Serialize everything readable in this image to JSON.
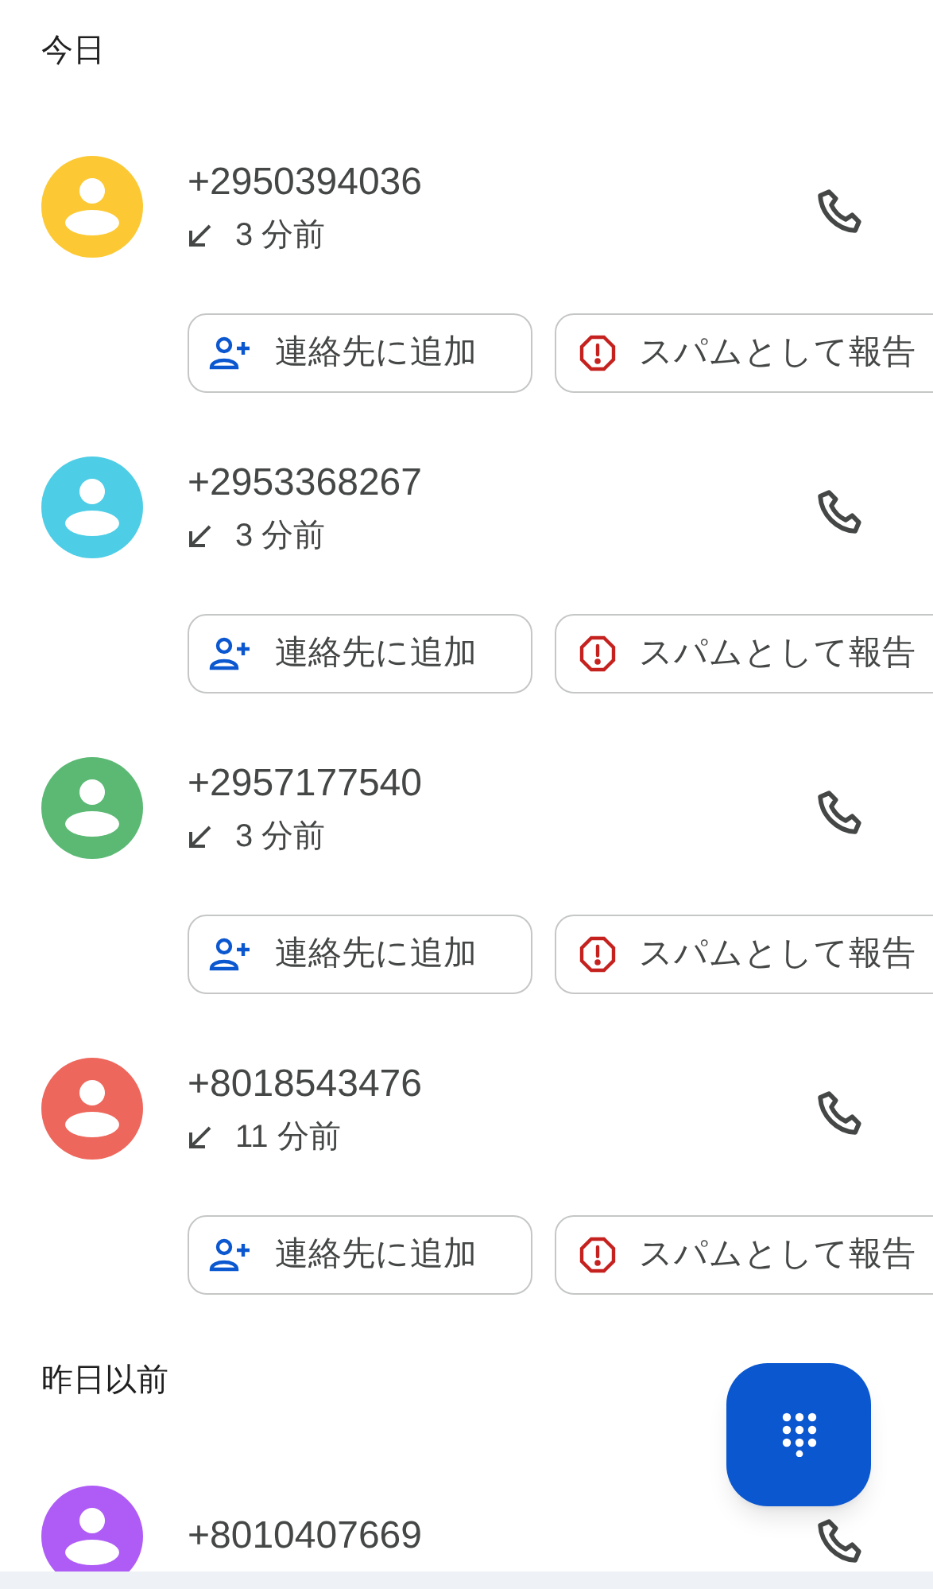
{
  "sections": [
    {
      "title": "今日",
      "calls": [
        {
          "number": "+2950394036",
          "time": "3 分前",
          "color": "#fcc934",
          "actions": [
            {
              "kind": "add_contact",
              "label": "連絡先に追加"
            },
            {
              "kind": "report_spam",
              "label": "スパムとして報告"
            }
          ]
        },
        {
          "number": "+2953368267",
          "time": "3 分前",
          "color": "#4ecde6",
          "actions": [
            {
              "kind": "add_contact",
              "label": "連絡先に追加"
            },
            {
              "kind": "report_spam",
              "label": "スパムとして報告"
            }
          ]
        },
        {
          "number": "+2957177540",
          "time": "3 分前",
          "color": "#5bb974",
          "actions": [
            {
              "kind": "add_contact",
              "label": "連絡先に追加"
            },
            {
              "kind": "report_spam",
              "label": "スパムとして報告"
            }
          ]
        },
        {
          "number": "+8018543476",
          "time": "11 分前",
          "color": "#ee675c",
          "actions": [
            {
              "kind": "add_contact",
              "label": "連絡先に追加"
            },
            {
              "kind": "report_spam",
              "label": "スパムとして報告"
            }
          ]
        }
      ]
    },
    {
      "title": "昨日以前",
      "calls": [
        {
          "number": "+8010407669",
          "color": "#af5cf7"
        }
      ]
    }
  ]
}
